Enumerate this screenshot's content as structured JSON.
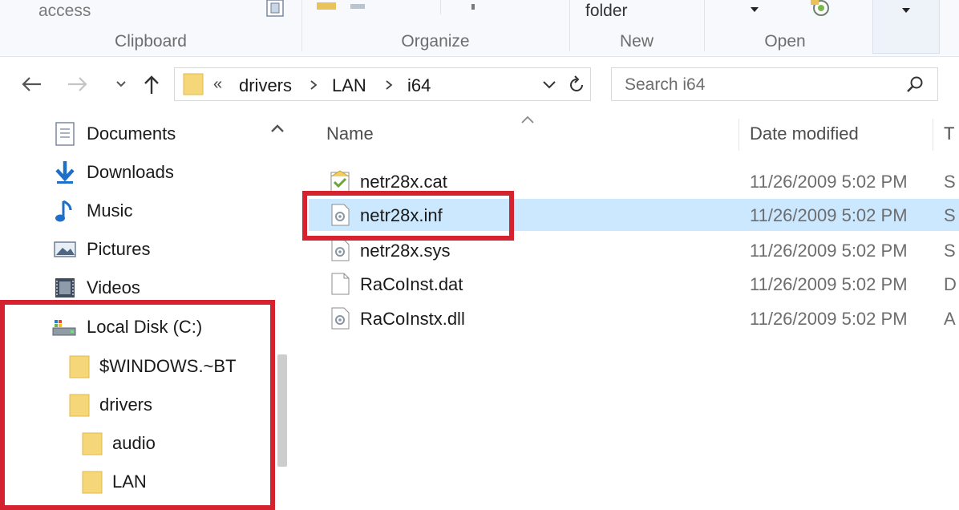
{
  "ribbon": {
    "quick_access_label": "access",
    "new_folder_label": "folder",
    "groups": {
      "clipboard": "Clipboard",
      "organize": "Organize",
      "new": "New",
      "open": "Open"
    }
  },
  "nav": {
    "breadcrumb": {
      "overflow": "«",
      "parts": [
        "drivers",
        "LAN",
        "i64"
      ]
    },
    "search_placeholder": "Search i64"
  },
  "navpane": {
    "items": [
      {
        "label": "Documents",
        "icon": "documents-icon"
      },
      {
        "label": "Downloads",
        "icon": "downloads-icon"
      },
      {
        "label": "Music",
        "icon": "music-icon"
      },
      {
        "label": "Pictures",
        "icon": "pictures-icon"
      },
      {
        "label": "Videos",
        "icon": "videos-icon"
      },
      {
        "label": "Local Disk (C:)",
        "icon": "drive-icon"
      },
      {
        "label": "$WINDOWS.~BT",
        "icon": "folder-icon"
      },
      {
        "label": "drivers",
        "icon": "folder-icon"
      },
      {
        "label": "audio",
        "icon": "folder-icon"
      },
      {
        "label": "LAN",
        "icon": "folder-icon"
      }
    ]
  },
  "files": {
    "columns": {
      "name": "Name",
      "date": "Date modified",
      "type": "T"
    },
    "rows": [
      {
        "name": "netr28x.cat",
        "date": "11/26/2009 5:02 PM",
        "type": "S",
        "icon": "catalog-file-icon",
        "selected": false
      },
      {
        "name": "netr28x.inf",
        "date": "11/26/2009 5:02 PM",
        "type": "S",
        "icon": "setup-info-file-icon",
        "selected": true
      },
      {
        "name": "netr28x.sys",
        "date": "11/26/2009 5:02 PM",
        "type": "S",
        "icon": "system-file-icon",
        "selected": false
      },
      {
        "name": "RaCoInst.dat",
        "date": "11/26/2009 5:02 PM",
        "type": "D",
        "icon": "generic-file-icon",
        "selected": false
      },
      {
        "name": "RaCoInstx.dll",
        "date": "11/26/2009 5:02 PM",
        "type": "A",
        "icon": "dll-file-icon",
        "selected": false
      }
    ]
  },
  "colors": {
    "selection": "#cce8ff",
    "highlight": "#d4232f",
    "folder": "#f5d77a"
  }
}
